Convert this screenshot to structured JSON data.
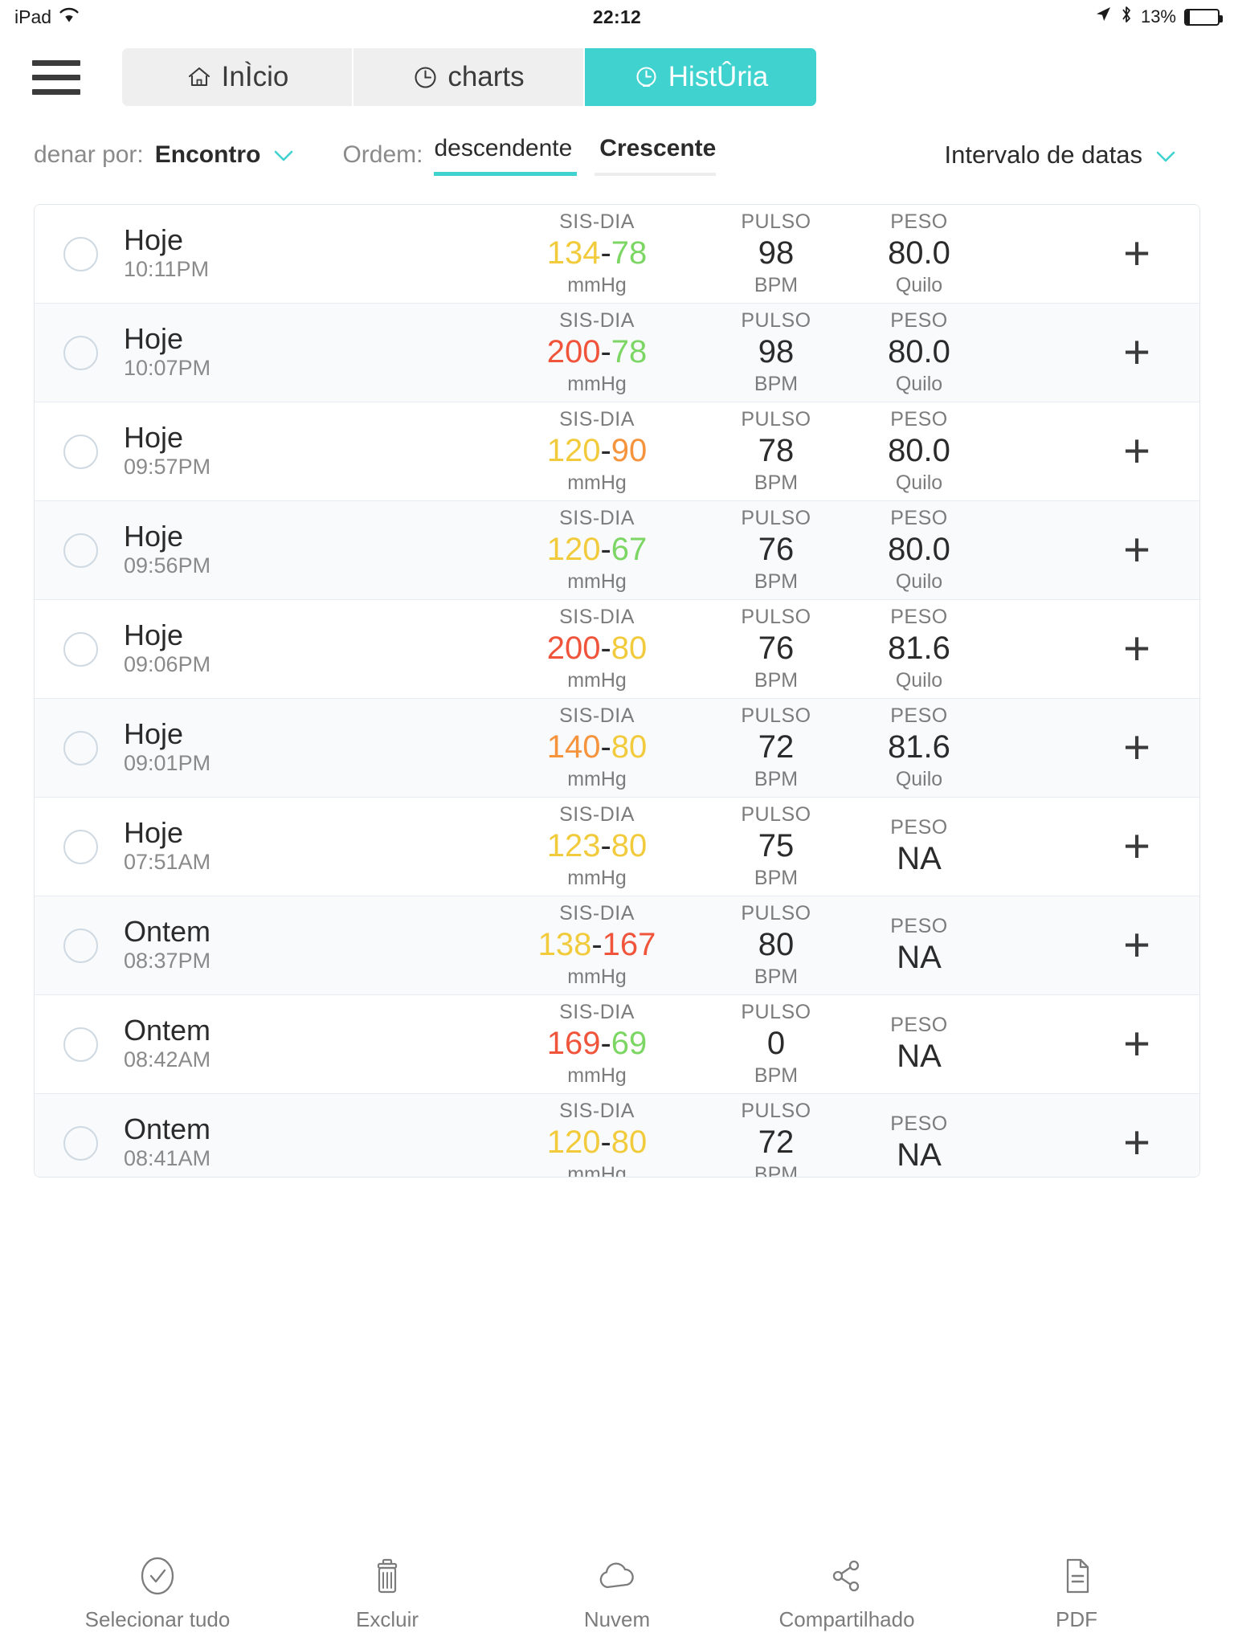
{
  "status_bar": {
    "device": "iPad",
    "wifi_icon": "wifi-icon",
    "time": "22:12",
    "location_icon": "location-arrow-icon",
    "bluetooth_icon": "bluetooth-icon",
    "battery_percent": "13%",
    "battery_level": 13
  },
  "top_nav": {
    "menu_icon": "hamburger-menu-icon",
    "tabs": [
      {
        "label": "InÌcio",
        "icon": "home-icon",
        "active": false
      },
      {
        "label": "charts",
        "icon": "clock-icon",
        "active": false
      },
      {
        "label": "HistÛria",
        "icon": "clock-icon",
        "active": true
      }
    ]
  },
  "filters": {
    "sort_label": "denar por:",
    "sort_value": "Encontro",
    "sort_chevron_icon": "chevron-down-icon",
    "order_label": "Ordem:",
    "order_descending": "descendente",
    "order_ascending": "Crescente",
    "order_selected": "descendente",
    "date_range_label": "Intervalo de datas",
    "date_range_chevron_icon": "chevron-down-icon"
  },
  "columns": {
    "bp_header": "SIS-DIA",
    "bp_unit": "mmHg",
    "pulse_header": "PULSO",
    "pulse_unit": "BPM",
    "weight_header": "PESO",
    "weight_unit": "Quilo",
    "add_icon": "plus-icon"
  },
  "colors": {
    "accent": "#3fd2cf",
    "green": "#7cd663",
    "yellow": "#f2cb3d",
    "orange": "#f5943c",
    "red": "#f0553c",
    "text": "#2b2b2b",
    "muted": "#7c7c7c",
    "row_alt": "#f8fafc"
  },
  "records": [
    {
      "day": "Hoje",
      "time": "10:11PM",
      "sys": "134",
      "sys_color": "#f2cb3d",
      "dia": "78",
      "dia_color": "#7cd663",
      "unit_bp": "mmHg",
      "pulse": "98",
      "unit_pulse": "BPM",
      "weight": "80.0",
      "unit_weight": "Quilo"
    },
    {
      "day": "Hoje",
      "time": "10:07PM",
      "sys": "200",
      "sys_color": "#f0553c",
      "dia": "78",
      "dia_color": "#7cd663",
      "unit_bp": "mmHg",
      "pulse": "98",
      "unit_pulse": "BPM",
      "weight": "80.0",
      "unit_weight": "Quilo"
    },
    {
      "day": "Hoje",
      "time": "09:57PM",
      "sys": "120",
      "sys_color": "#f2cb3d",
      "dia": "90",
      "dia_color": "#f5943c",
      "unit_bp": "mmHg",
      "pulse": "78",
      "unit_pulse": "BPM",
      "weight": "80.0",
      "unit_weight": "Quilo"
    },
    {
      "day": "Hoje",
      "time": "09:56PM",
      "sys": "120",
      "sys_color": "#f2cb3d",
      "dia": "67",
      "dia_color": "#7cd663",
      "unit_bp": "mmHg",
      "pulse": "76",
      "unit_pulse": "BPM",
      "weight": "80.0",
      "unit_weight": "Quilo"
    },
    {
      "day": "Hoje",
      "time": "09:06PM",
      "sys": "200",
      "sys_color": "#f0553c",
      "dia": "80",
      "dia_color": "#f2cb3d",
      "unit_bp": "mmHg",
      "pulse": "76",
      "unit_pulse": "BPM",
      "weight": "81.6",
      "unit_weight": "Quilo"
    },
    {
      "day": "Hoje",
      "time": "09:01PM",
      "sys": "140",
      "sys_color": "#f5943c",
      "dia": "80",
      "dia_color": "#f2cb3d",
      "unit_bp": "mmHg",
      "pulse": "72",
      "unit_pulse": "BPM",
      "weight": "81.6",
      "unit_weight": "Quilo"
    },
    {
      "day": "Hoje",
      "time": "07:51AM",
      "sys": "123",
      "sys_color": "#f2cb3d",
      "dia": "80",
      "dia_color": "#f2cb3d",
      "unit_bp": "mmHg",
      "pulse": "75",
      "unit_pulse": "BPM",
      "weight": "NA",
      "unit_weight": ""
    },
    {
      "day": "Ontem",
      "time": "08:37PM",
      "sys": "138",
      "sys_color": "#f2cb3d",
      "dia": "167",
      "dia_color": "#f0553c",
      "unit_bp": "mmHg",
      "pulse": "80",
      "unit_pulse": "BPM",
      "weight": "NA",
      "unit_weight": ""
    },
    {
      "day": "Ontem",
      "time": "08:42AM",
      "sys": "169",
      "sys_color": "#f0553c",
      "dia": "69",
      "dia_color": "#7cd663",
      "unit_bp": "mmHg",
      "pulse": "0",
      "unit_pulse": "BPM",
      "weight": "NA",
      "unit_weight": ""
    },
    {
      "day": "Ontem",
      "time": "08:41AM",
      "sys": "120",
      "sys_color": "#f2cb3d",
      "dia": "80",
      "dia_color": "#f2cb3d",
      "unit_bp": "mmHg",
      "pulse": "72",
      "unit_pulse": "BPM",
      "weight": "NA",
      "unit_weight": ""
    }
  ],
  "bottom_toolbar": [
    {
      "label": "Selecionar tudo",
      "icon": "check-circle-icon"
    },
    {
      "label": "Excluir",
      "icon": "trash-icon"
    },
    {
      "label": "Nuvem",
      "icon": "cloud-icon"
    },
    {
      "label": "Compartilhado",
      "icon": "share-icon"
    },
    {
      "label": "PDF",
      "icon": "document-icon"
    }
  ]
}
